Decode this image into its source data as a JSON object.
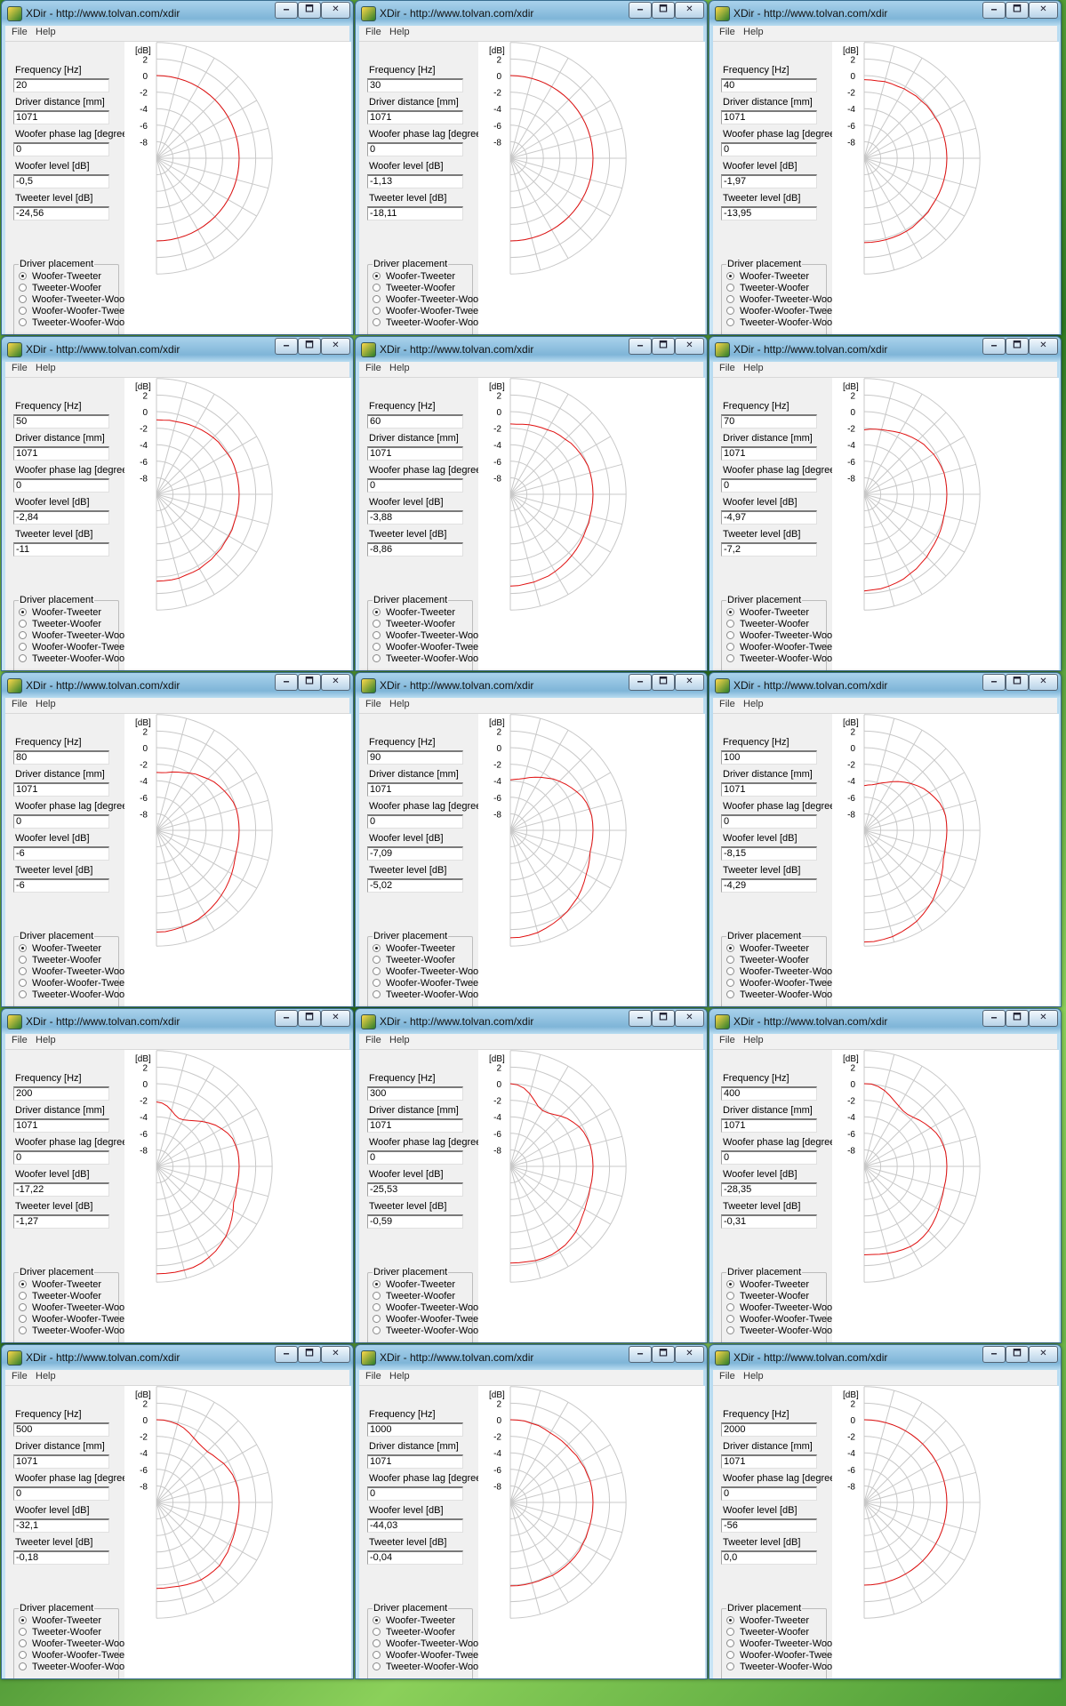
{
  "app": {
    "title": "XDir - http://www.tolvan.com/xdir",
    "menu": [
      "File",
      "Help"
    ],
    "window_buttons": {
      "minimize": "🗕",
      "maximize": "🗖",
      "close": "✕"
    }
  },
  "labels": {
    "frequency": "Frequency [Hz]",
    "driver_distance": "Driver distance [mm]",
    "phase_lag": "Woofer phase lag [degrees]",
    "woofer_level": "Woofer level [dB]",
    "tweeter_level": "Tweeter level [dB]",
    "driver_placement": "Driver placement",
    "plot_unit": "[dB]"
  },
  "placement_options": [
    "Woofer-Tweeter",
    "Tweeter-Woofer",
    "Woofer-Tweeter-Woofer",
    "Woofer-Woofer-Tweeter",
    "Tweeter-Woofer-Woofer"
  ],
  "selected_placement": "Woofer-Tweeter",
  "plot": {
    "db_ticks": [
      "2",
      "0",
      "-2",
      "-4",
      "-6",
      "-8"
    ],
    "db_range": [
      -10,
      3
    ],
    "curve_color": "#e01010",
    "grid_color": "#c8c8c8"
  },
  "windows": [
    {
      "frequency": "20",
      "driver_distance": "1071",
      "phase_lag": "0",
      "woofer_level": "-0,5",
      "tweeter_level": "-24,56",
      "response_db": [
        0,
        0,
        0,
        0,
        0,
        0,
        0,
        0,
        0,
        0,
        0,
        0,
        0,
        0,
        0,
        0,
        0,
        0,
        0,
        0,
        0,
        0,
        0,
        0,
        0,
        0,
        0,
        0,
        0,
        0,
        0,
        0,
        0,
        0,
        0,
        0,
        0
      ]
    },
    {
      "frequency": "30",
      "driver_distance": "1071",
      "phase_lag": "0",
      "woofer_level": "-1,13",
      "tweeter_level": "-18,11",
      "response_db": [
        0,
        0,
        0,
        0,
        0,
        0,
        0,
        0,
        0,
        0,
        0,
        0,
        0,
        0,
        0,
        0,
        0,
        0,
        0,
        0,
        0,
        0,
        0,
        0,
        0,
        0,
        0,
        0,
        0,
        0,
        0,
        0,
        0,
        0,
        0,
        0,
        0
      ]
    },
    {
      "frequency": "40",
      "driver_distance": "1071",
      "phase_lag": "0",
      "woofer_level": "-1,97",
      "tweeter_level": "-13,95",
      "response_db": [
        -0.5,
        -0.5,
        -0.5,
        -0.4,
        -0.4,
        -0.4,
        -0.3,
        -0.3,
        -0.2,
        -0.2,
        -0.1,
        -0.1,
        -0.1,
        0,
        0,
        0,
        0,
        0,
        0,
        0,
        0,
        0,
        0,
        0,
        0,
        0,
        0.1,
        0.1,
        0.1,
        0.2,
        0.2,
        0.2,
        0.2,
        0.2,
        0.2,
        0.2,
        0.2
      ]
    },
    {
      "frequency": "50",
      "driver_distance": "1071",
      "phase_lag": "0",
      "woofer_level": "-2,84",
      "tweeter_level": "-11",
      "response_db": [
        -1,
        -1,
        -0.9,
        -0.9,
        -0.8,
        -0.7,
        -0.6,
        -0.5,
        -0.4,
        -0.3,
        -0.2,
        -0.2,
        -0.1,
        0,
        0,
        0,
        0,
        0,
        0,
        0,
        0,
        0,
        0,
        0.1,
        0.1,
        0.1,
        0.2,
        0.2,
        0.3,
        0.3,
        0.4,
        0.4,
        0.4,
        0.5,
        0.5,
        0.5,
        0.5
      ]
    },
    {
      "frequency": "60",
      "driver_distance": "1071",
      "phase_lag": "0",
      "woofer_level": "-3,88",
      "tweeter_level": "-8,86",
      "response_db": [
        -1.5,
        -1.5,
        -1.4,
        -1.3,
        -1.2,
        -1.1,
        -1,
        -0.8,
        -0.7,
        -0.6,
        -0.4,
        -0.3,
        -0.2,
        -0.1,
        0,
        0,
        0,
        0,
        0,
        0,
        0,
        0,
        0.1,
        0.1,
        0.2,
        0.3,
        0.4,
        0.5,
        0.6,
        0.7,
        0.8,
        0.9,
        0.9,
        1,
        1,
        1.1,
        1.1
      ]
    },
    {
      "frequency": "70",
      "driver_distance": "1071",
      "phase_lag": "0",
      "woofer_level": "-4,97",
      "tweeter_level": "-7,2",
      "response_db": [
        -2.2,
        -2.1,
        -2,
        -1.9,
        -1.8,
        -1.6,
        -1.4,
        -1.2,
        -1,
        -0.8,
        -0.6,
        -0.5,
        -0.3,
        -0.2,
        -0.1,
        0,
        0,
        0,
        0,
        0,
        0,
        0,
        0.1,
        0.2,
        0.3,
        0.4,
        0.5,
        0.7,
        0.8,
        1,
        1.1,
        1.3,
        1.4,
        1.5,
        1.6,
        1.6,
        1.7
      ]
    },
    {
      "frequency": "80",
      "driver_distance": "1071",
      "phase_lag": "0",
      "woofer_level": "-6",
      "tweeter_level": "-6",
      "response_db": [
        -3,
        -3,
        -2.9,
        -2.7,
        -2.5,
        -2.3,
        -2,
        -1.7,
        -1.5,
        -1.2,
        -0.9,
        -0.7,
        -0.5,
        -0.3,
        -0.1,
        0,
        0,
        0,
        0,
        0,
        0,
        0,
        0.1,
        0.3,
        0.5,
        0.7,
        0.9,
        1.1,
        1.3,
        1.5,
        1.7,
        1.9,
        2,
        2.1,
        2.2,
        2.3,
        2.3
      ]
    },
    {
      "frequency": "90",
      "driver_distance": "1071",
      "phase_lag": "0",
      "woofer_level": "-7,09",
      "tweeter_level": "-5,02",
      "response_db": [
        -3.9,
        -3.8,
        -3.7,
        -3.5,
        -3.2,
        -2.9,
        -2.6,
        -2.3,
        -1.9,
        -1.6,
        -1.3,
        -1,
        -0.7,
        -0.4,
        -0.2,
        -0.1,
        0,
        0,
        0,
        0,
        0,
        0,
        0.2,
        0.4,
        0.6,
        0.9,
        1.2,
        1.5,
        1.7,
        2,
        2.2,
        2.4,
        2.6,
        2.8,
        2.9,
        3,
        3
      ]
    },
    {
      "frequency": "100",
      "driver_distance": "1071",
      "phase_lag": "0",
      "woofer_level": "-8,15",
      "tweeter_level": "-4,29",
      "response_db": [
        -4.6,
        -4.5,
        -4.4,
        -4.2,
        -3.9,
        -3.6,
        -3.2,
        -2.8,
        -2.4,
        -2,
        -1.6,
        -1.2,
        -0.9,
        -0.6,
        -0.3,
        -0.1,
        0,
        0,
        0,
        0,
        0,
        0.1,
        0.2,
        0.5,
        0.8,
        1.1,
        1.4,
        1.8,
        2.1,
        2.4,
        2.7,
        2.9,
        3.1,
        3.3,
        3.4,
        3.5,
        3.5
      ]
    },
    {
      "frequency": "200",
      "driver_distance": "1071",
      "phase_lag": "0",
      "woofer_level": "-17,22",
      "tweeter_level": "-1,27",
      "response_db": [
        -2.2,
        -2.3,
        -2.6,
        -3,
        -3.4,
        -3.6,
        -3.5,
        -3.2,
        -2.8,
        -2.3,
        -1.8,
        -1.3,
        -0.9,
        -0.5,
        -0.2,
        -0.1,
        0,
        0,
        0,
        0,
        0,
        0,
        0.2,
        0.3,
        0.7,
        1.1,
        1.5,
        1.9,
        2.2,
        2.5,
        2.7,
        2.9,
        3,
        3,
        3,
        3,
        3
      ]
    },
    {
      "frequency": "300",
      "driver_distance": "1071",
      "phase_lag": "0",
      "woofer_level": "-25,53",
      "tweeter_level": "-0,59",
      "response_db": [
        0,
        -0.1,
        -0.4,
        -0.9,
        -1.5,
        -2,
        -2.2,
        -2.1,
        -1.8,
        -1.4,
        -1,
        -0.7,
        -0.4,
        -0.2,
        -0.1,
        0,
        0,
        0,
        0,
        0,
        0,
        0,
        0.1,
        0.2,
        0.4,
        0.6,
        0.9,
        1.2,
        1.4,
        1.6,
        1.7,
        1.8,
        1.8,
        1.8,
        1.7,
        1.7,
        1.7
      ]
    },
    {
      "frequency": "400",
      "driver_distance": "1071",
      "phase_lag": "0",
      "woofer_level": "-28,35",
      "tweeter_level": "-0,31",
      "response_db": [
        0,
        0,
        -0.2,
        -0.5,
        -0.9,
        -1.3,
        -1.6,
        -1.8,
        -1.8,
        -1.6,
        -1.3,
        -1,
        -0.7,
        -0.4,
        -0.2,
        -0.1,
        0,
        0,
        0,
        0,
        0,
        0,
        0.1,
        0.2,
        0.4,
        0.6,
        0.8,
        1,
        1.1,
        1.2,
        1.2,
        1.1,
        1,
        0.9,
        0.8,
        0.7,
        0.7
      ]
    },
    {
      "frequency": "500",
      "driver_distance": "1071",
      "phase_lag": "0",
      "woofer_level": "-32,1",
      "tweeter_level": "-0,18",
      "response_db": [
        0,
        0,
        -0.1,
        -0.2,
        -0.4,
        -0.7,
        -1,
        -1.2,
        -1.3,
        -1.3,
        -1.1,
        -0.9,
        -0.6,
        -0.4,
        -0.2,
        -0.1,
        0,
        0,
        0,
        0,
        0,
        0,
        0.1,
        0.2,
        0.3,
        0.5,
        0.6,
        0.8,
        0.8,
        0.8,
        0.8,
        0.7,
        0.6,
        0.5,
        0.4,
        0.4,
        0.4
      ]
    },
    {
      "frequency": "1000",
      "driver_distance": "1071",
      "phase_lag": "0",
      "woofer_level": "-44,03",
      "tweeter_level": "-0,04",
      "response_db": [
        0,
        0,
        0,
        -0.1,
        -0.1,
        -0.2,
        -0.3,
        -0.3,
        -0.3,
        -0.3,
        -0.3,
        -0.2,
        -0.2,
        -0.1,
        -0.1,
        0,
        0,
        0,
        0,
        0,
        0,
        0,
        0,
        0.1,
        0.1,
        0.2,
        0.2,
        0.2,
        0.2,
        0.2,
        0.2,
        0.1,
        0.1,
        0.1,
        0.1,
        0.1,
        0.1
      ]
    },
    {
      "frequency": "2000",
      "driver_distance": "1071",
      "phase_lag": "0",
      "woofer_level": "-56",
      "tweeter_level": "0,0",
      "response_db": [
        0,
        0,
        0,
        0,
        0,
        0,
        0,
        0,
        0,
        0,
        0,
        0,
        0,
        0,
        0,
        0,
        0,
        0,
        0,
        0,
        0,
        0,
        0,
        0,
        0,
        0,
        0,
        0,
        0,
        0,
        0,
        0,
        0,
        0,
        0,
        0,
        0
      ]
    }
  ]
}
